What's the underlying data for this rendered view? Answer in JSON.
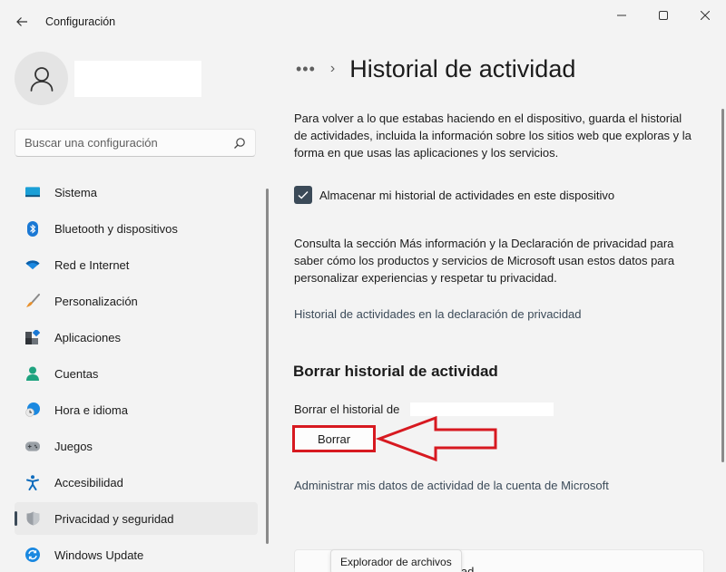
{
  "window": {
    "app_title": "Configuración",
    "back_icon": "arrow-left-icon",
    "controls": {
      "minimize_icon": "minimize-icon",
      "maximize_icon": "maximize-icon",
      "close_icon": "close-icon"
    }
  },
  "sidebar": {
    "profile": {
      "avatar_icon": "person-icon",
      "name": ""
    },
    "search": {
      "placeholder": "Buscar una configuración",
      "value": "",
      "icon": "search-icon"
    },
    "items": [
      {
        "label": "Sistema",
        "icon": "monitor-icon",
        "color": "#0078d4",
        "selected": false
      },
      {
        "label": "Bluetooth y dispositivos",
        "icon": "bluetooth-icon",
        "color": "#0078d4",
        "selected": false
      },
      {
        "label": "Red e Internet",
        "icon": "wifi-icon",
        "color": "#0078d4",
        "selected": false
      },
      {
        "label": "Personalización",
        "icon": "brush-icon",
        "color": "#e8912d",
        "selected": false
      },
      {
        "label": "Aplicaciones",
        "icon": "apps-icon",
        "color": "#3b4a58",
        "selected": false
      },
      {
        "label": "Cuentas",
        "icon": "account-icon",
        "color": "#1fa37f",
        "selected": false
      },
      {
        "label": "Hora e idioma",
        "icon": "globe-clock-icon",
        "color": "#0078d4",
        "selected": false
      },
      {
        "label": "Juegos",
        "icon": "gamepad-icon",
        "color": "#8a8a8a",
        "selected": false
      },
      {
        "label": "Accesibilidad",
        "icon": "accessibility-icon",
        "color": "#0f6cbd",
        "selected": false
      },
      {
        "label": "Privacidad y seguridad",
        "icon": "shield-icon",
        "color": "#8a8a8a",
        "selected": true
      },
      {
        "label": "Windows Update",
        "icon": "update-icon",
        "color": "#0078d4",
        "selected": false
      }
    ]
  },
  "main": {
    "breadcrumb": {
      "more": "•••",
      "separator": "›",
      "title": "Historial de actividad"
    },
    "description": "Para volver a lo que estabas haciendo en el dispositivo, guarda el historial de actividades, incluida la información sobre los sitios web que exploras y la forma en que usas las aplicaciones y los servicios.",
    "store_checkbox": {
      "label": "Almacenar mi historial de actividades en este dispositivo",
      "checked": true
    },
    "privacy_text": "Consulta la sección Más información y la Declaración de privacidad para saber cómo los productos y servicios de Microsoft usan estos datos para personalizar experiencias y respetar tu privacidad.",
    "privacy_link": "Historial de actividades en la declaración de privacidad",
    "clear_section": {
      "title": "Borrar historial de actividad",
      "label": "Borrar el historial de",
      "account": "",
      "button": "Borrar"
    },
    "manage_link": "Administrar mis datos de actividad de la cuenta de Microsoft",
    "bottom_card_text": "lad",
    "tooltip": "Explorador de archivos"
  },
  "annotation": {
    "color": "#d71920",
    "arrow_icon": "arrow-left-annotation-icon"
  }
}
